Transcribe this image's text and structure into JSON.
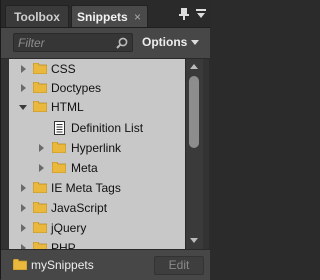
{
  "tabs": [
    {
      "label": "Toolbox",
      "active": false
    },
    {
      "label": "Snippets",
      "active": true,
      "close": "×"
    }
  ],
  "toolbar": {
    "filter_placeholder": "Filter",
    "options_label": "Options"
  },
  "tree": [
    {
      "label": "CSS",
      "type": "folder",
      "expanded": false
    },
    {
      "label": "Doctypes",
      "type": "folder",
      "expanded": false
    },
    {
      "label": "HTML",
      "type": "folder",
      "expanded": true
    },
    {
      "label": "Definition List",
      "type": "snippet"
    },
    {
      "label": "Hyperlink",
      "type": "folder",
      "expanded": false
    },
    {
      "label": "Meta",
      "type": "folder",
      "expanded": false
    },
    {
      "label": "IE Meta Tags",
      "type": "folder",
      "expanded": false
    },
    {
      "label": "JavaScript",
      "type": "folder",
      "expanded": false
    },
    {
      "label": "jQuery",
      "type": "folder",
      "expanded": false
    },
    {
      "label": "PHP",
      "type": "folder",
      "expanded": false
    }
  ],
  "footer": {
    "folder_label": "mySnippets",
    "edit_label": "Edit"
  },
  "colors": {
    "folder": "#e9b83c",
    "tree_bg": "#c8c8c8",
    "panel_bg": "#474747"
  }
}
